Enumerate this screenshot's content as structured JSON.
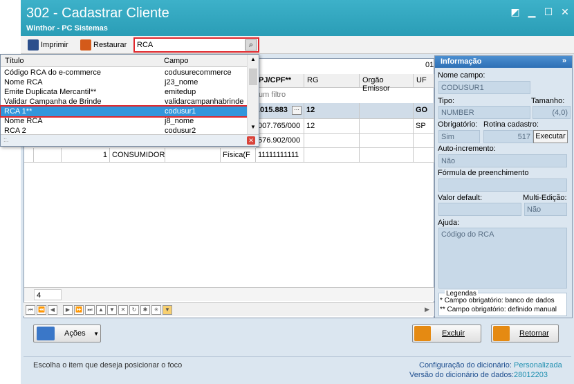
{
  "window": {
    "title": "302 - Cadastrar Cliente",
    "subtitle": "Winthor - PC Sistemas"
  },
  "toolbar": {
    "print_label": "Imprimir",
    "restore_label": "Restaurar",
    "search_value": "RCA"
  },
  "dropdown": {
    "headers": [
      "Título",
      "Campo"
    ],
    "rows": [
      {
        "title": "Código RCA do e-commerce",
        "field": "codusurecommerce"
      },
      {
        "title": "Nome RCA",
        "field": "j23_nome"
      },
      {
        "title": "Emite Duplicata Mercantil**",
        "field": "emitedup"
      },
      {
        "title": "Validar Campanha de Brinde",
        "field": "validarcampanhabrinde"
      },
      {
        "title": "RCA 1**",
        "field": "codusur1"
      },
      {
        "title": "Nome RCA",
        "field": "j8_nome"
      },
      {
        "title": "RCA 2",
        "field": "codusur2"
      }
    ],
    "footer": "::."
  },
  "grid": {
    "count_label": "01",
    "headers": [
      "PJ/CPF**",
      "RG",
      "Orgão Emissor",
      "UF"
    ],
    "filter_text": "um filtro",
    "rows": [
      {
        "cpf": ".015.883",
        "rg": "12",
        "orgao": "",
        "uf": "GO"
      },
      {
        "cpf": "007.765/000",
        "rg": "12",
        "orgao": "",
        "uf": "SP"
      },
      {
        "cpf": "576.902/000",
        "rg": "",
        "orgao": "",
        "uf": ""
      },
      {
        "num": "1",
        "name": "CONSUMIDOR F",
        "type": "Física(F",
        "cpf": "11111111111",
        "rg": "",
        "orgao": "",
        "uf": ""
      }
    ],
    "footer_count": "4"
  },
  "info_panel": {
    "title": "Informação",
    "nome_campo_label": "Nome campo:",
    "nome_campo": "CODUSUR1",
    "tipo_label": "Tipo:",
    "tamanho_label": "Tamanho:",
    "tipo": "NUMBER",
    "tamanho": "(4,0)",
    "obrigatorio_label": "Obrigatório:",
    "rotina_label": "Rotina cadastro:",
    "obrigatorio": "Sim",
    "rotina": "517",
    "executar_label": "Executar",
    "auto_label": "Auto-incremento:",
    "auto": "Não",
    "formula_label": "Fórmula de preenchimento",
    "formula": "",
    "valor_label": "Valor default:",
    "multi_label": "Multi-Edição:",
    "valor": "",
    "multi": "Não",
    "ajuda_label": "Ajuda:",
    "ajuda": "Código do RCA",
    "legendas_label": "Legendas",
    "legend1": "* Campo obrigatório: banco de dados",
    "legend2": "** Campo obrigatório: definido manual"
  },
  "buttons": {
    "acoes": "Ações",
    "excluir": "Excluir",
    "retornar": "Retornar"
  },
  "status": {
    "hint": "Escolha o item que deseja posicionar o foco",
    "config_label": "Configuração do dicionário:",
    "config_value": "Personalizada",
    "version_label": "Versão do dicionário de dados:",
    "version_value": "28012203"
  },
  "colors": {
    "title_bar": "#2fa5be",
    "accent": "#3296dc",
    "highlight": "#e0262b",
    "panel_bg": "#dbe6f0"
  }
}
